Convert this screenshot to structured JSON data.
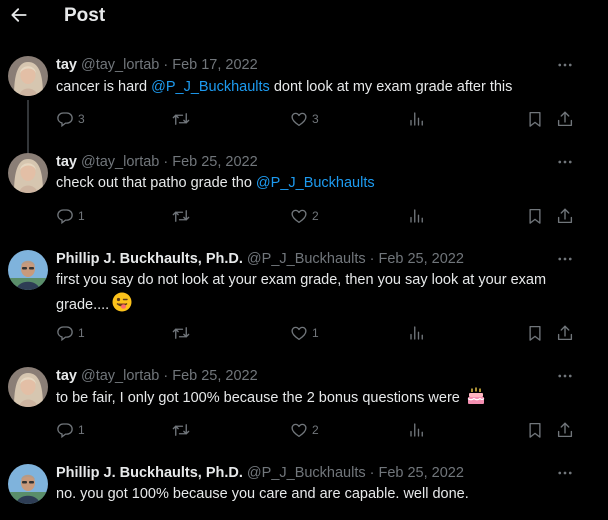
{
  "header": {
    "title": "Post"
  },
  "tweets": [
    {
      "name": "tay",
      "handle": "@tay_lortab",
      "separator": "·",
      "date": "Feb 17, 2022",
      "text_before": "cancer is hard ",
      "mention": "@P_J_Buckhaults",
      "text_after": " dont look at my exam grade after this",
      "replies": "3",
      "likes": "3",
      "avatar_icon": "profile-photo-tay"
    },
    {
      "name": "tay",
      "handle": "@tay_lortab",
      "separator": "·",
      "date": "Feb 25, 2022",
      "text_before": "check out that patho grade tho ",
      "mention": "@P_J_Buckhaults",
      "text_after": "",
      "replies": "1",
      "likes": "2",
      "avatar_icon": "profile-photo-tay"
    },
    {
      "name": "Phillip J. Buckhaults, Ph.D.",
      "handle": "@P_J_Buckhaults",
      "separator": "·",
      "date": "Feb 25, 2022",
      "text_before": "first you say do not look at your exam grade, then you say look at your exam grade....",
      "emoji": "winking-face-with-tongue",
      "replies": "1",
      "likes": "1",
      "avatar_icon": "profile-photo-phillip"
    },
    {
      "name": "tay",
      "handle": "@tay_lortab",
      "separator": "·",
      "date": "Feb 25, 2022",
      "text_before": "to be fair, I only got 100% because the 2 bonus questions were",
      "emoji": "birthday-cake",
      "replies": "1",
      "likes": "2",
      "avatar_icon": "profile-photo-tay"
    },
    {
      "name": "Phillip J. Buckhaults, Ph.D.",
      "handle": "@P_J_Buckhaults",
      "separator": "·",
      "date": "Feb 25, 2022",
      "text_before": "no.  you got 100% because you care and are capable.  well done.",
      "avatar_icon": "profile-photo-phillip"
    }
  ],
  "colors": {
    "background": "#000000",
    "text": "#e7e9ea",
    "muted": "#71767b",
    "accent": "#1d9bf0",
    "thread_line": "#333639"
  }
}
